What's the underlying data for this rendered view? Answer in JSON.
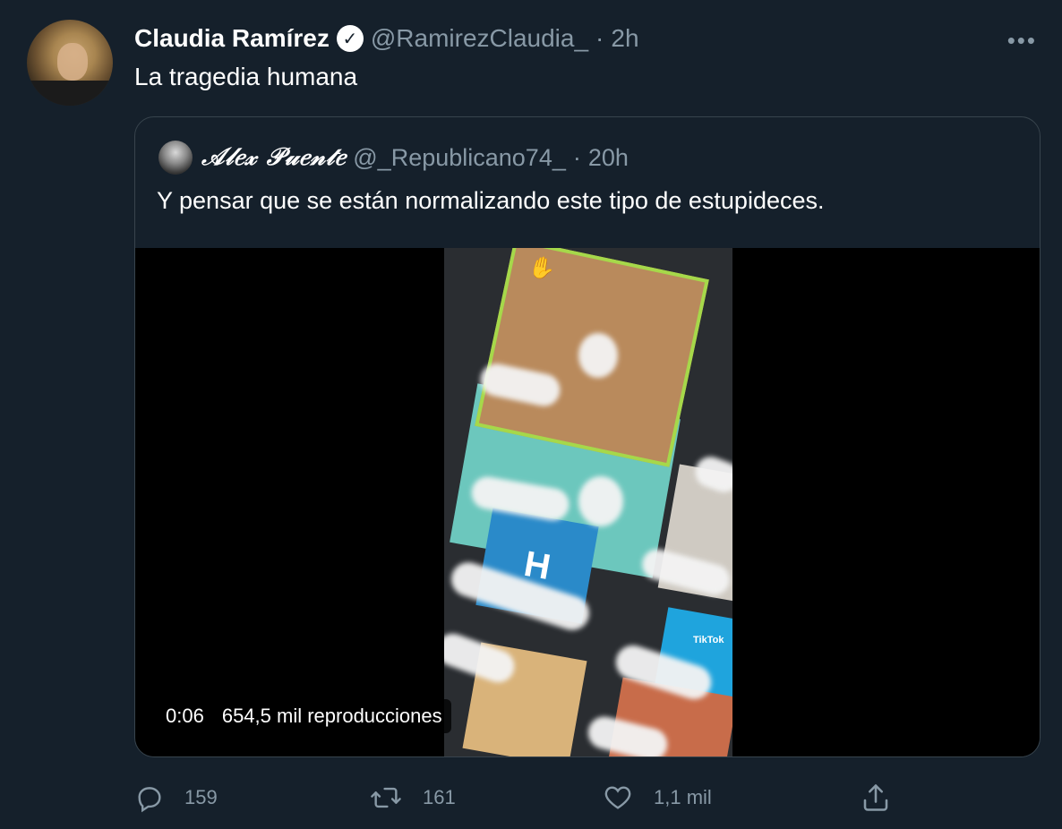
{
  "author": {
    "name": "Claudia Ramírez",
    "handle": "@RamirezClaudia_",
    "separator": "·",
    "time": "2h",
    "text": "La tragedia humana"
  },
  "quote": {
    "name": "𝒜𝓁𝑒𝓍 𝒫𝓊𝑒𝓃𝓉𝑒",
    "handle": "@_Republicano74_",
    "separator": "·",
    "time": "20h",
    "text": "Y pensar que se están normalizando este tipo de estupideces.",
    "video": {
      "duration": "0:06",
      "views": "654,5 mil reproducciones",
      "tile_letter": "H",
      "watermark": "TikTok"
    }
  },
  "actions": {
    "replies": "159",
    "retweets": "161",
    "likes": "1,1 mil"
  },
  "more_label": "•••",
  "colors": {
    "background": "#15202b",
    "secondary_text": "#8899a6",
    "border": "#38444d"
  }
}
